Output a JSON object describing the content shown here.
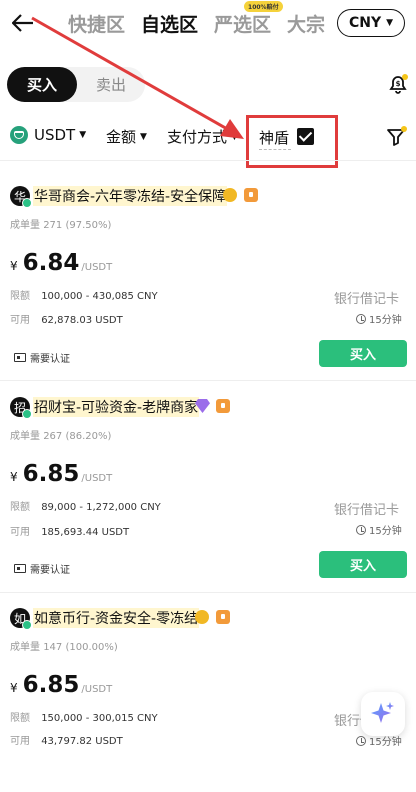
{
  "header": {
    "tabs": [
      {
        "label": "快捷区"
      },
      {
        "label": "自选区"
      },
      {
        "label": "严选区",
        "badge": "100%赔付"
      },
      {
        "label": "大宗"
      }
    ],
    "currency": "CNY"
  },
  "trade_toggle": {
    "buy": "买入",
    "sell": "卖出"
  },
  "filters": {
    "asset": "USDT",
    "amount": "金额",
    "payment": "支付方式",
    "shield": "神盾"
  },
  "listings": [
    {
      "avatar": "华",
      "name": "华哥商会-六年零冻结-安全保障",
      "stat_label": "成单量",
      "stat_value": "271 (97.50%)",
      "currency_symbol": "¥",
      "price": "6.84",
      "unit": "/USDT",
      "limit_label": "限额",
      "limit": "100,000 - 430,085 CNY",
      "avail_label": "可用",
      "available": "62,878.03 USDT",
      "payment": "银行借记卡",
      "time": "15分钟",
      "auth": "需要认证",
      "action": "买入"
    },
    {
      "avatar": "招",
      "name": "招财宝-可验资金-老牌商家",
      "stat_label": "成单量",
      "stat_value": "267 (86.20%)",
      "currency_symbol": "¥",
      "price": "6.85",
      "unit": "/USDT",
      "limit_label": "限额",
      "limit": "89,000 - 1,272,000 CNY",
      "avail_label": "可用",
      "available": "185,693.44 USDT",
      "payment": "银行借记卡",
      "time": "15分钟",
      "auth": "需要认证",
      "action": "买入"
    },
    {
      "avatar": "如",
      "name": "如意币行-资金安全-零冻结",
      "stat_label": "成单量",
      "stat_value": "147 (100.00%)",
      "currency_symbol": "¥",
      "price": "6.85",
      "unit": "/USDT",
      "limit_label": "限额",
      "limit": "150,000 - 300,015 CNY",
      "avail_label": "可用",
      "available": "43,797.82 USDT",
      "payment": "银行借记卡",
      "time": "15分钟"
    }
  ],
  "colors": {
    "accent_green": "#2bbf7c",
    "highlight_red": "#e03c3c",
    "name_highlight": "#fff6cf"
  }
}
